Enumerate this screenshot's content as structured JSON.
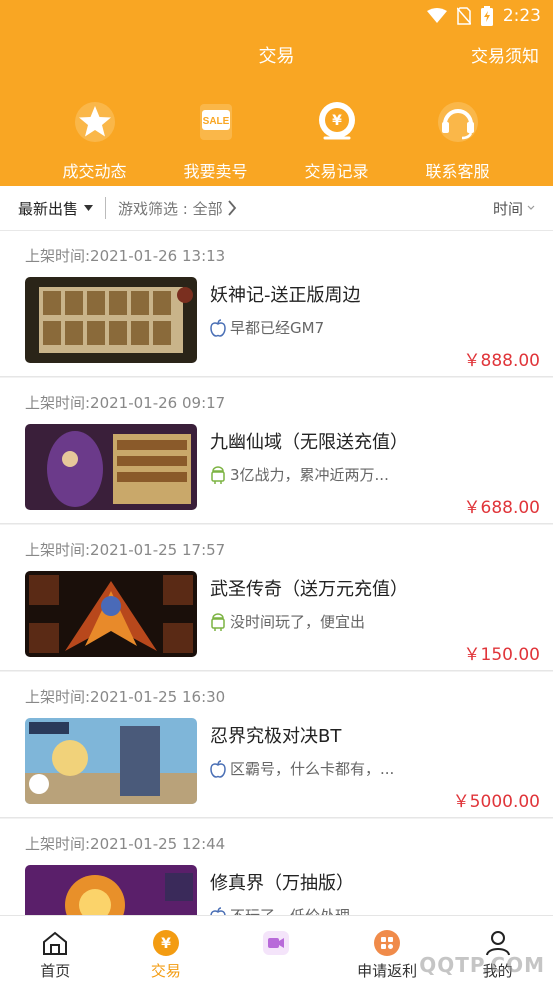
{
  "status": {
    "time": "2:23"
  },
  "header": {
    "title": "交易",
    "notice": "交易须知"
  },
  "quick": [
    {
      "label": "成交动态",
      "icon": "star-icon"
    },
    {
      "label": "我要卖号",
      "icon": "sale-tag-icon"
    },
    {
      "label": "交易记录",
      "icon": "yuan-record-icon"
    },
    {
      "label": "联系客服",
      "icon": "headset-icon"
    }
  ],
  "filter": {
    "latest": "最新出售",
    "game_filter": "游戏筛选 : 全部",
    "time": "时间"
  },
  "listings": [
    {
      "time": "上架时间:2021-01-26 13:13",
      "name": "妖神记-送正版周边",
      "platform": "apple",
      "desc": "早都已经GM7",
      "price": "￥888.00"
    },
    {
      "time": "上架时间:2021-01-26 09:17",
      "name": "九幽仙域（无限送充值）",
      "platform": "android",
      "desc": "3亿战力，累冲近两万...",
      "price": "￥688.00"
    },
    {
      "time": "上架时间:2021-01-25 17:57",
      "name": "武圣传奇（送万元充值）",
      "platform": "android",
      "desc": "没时间玩了，便宜出",
      "price": "￥150.00"
    },
    {
      "time": "上架时间:2021-01-25 16:30",
      "name": "忍界究极对决BT",
      "platform": "apple",
      "desc": "区霸号，什么卡都有，...",
      "price": "￥5000.00"
    },
    {
      "time": "上架时间:2021-01-25 12:44",
      "name": "修真界（万抽版）",
      "platform": "apple",
      "desc": "不玩了，低价处理",
      "price": ""
    }
  ],
  "tabs": [
    {
      "label": "首页",
      "active": false
    },
    {
      "label": "交易",
      "active": true
    },
    {
      "label": "",
      "active": false
    },
    {
      "label": "申请返利",
      "active": false
    },
    {
      "label": "我的",
      "active": false
    }
  ],
  "watermark": "QQTP.COM",
  "colors": {
    "brand": "#f9a623",
    "price": "#e0353a"
  }
}
